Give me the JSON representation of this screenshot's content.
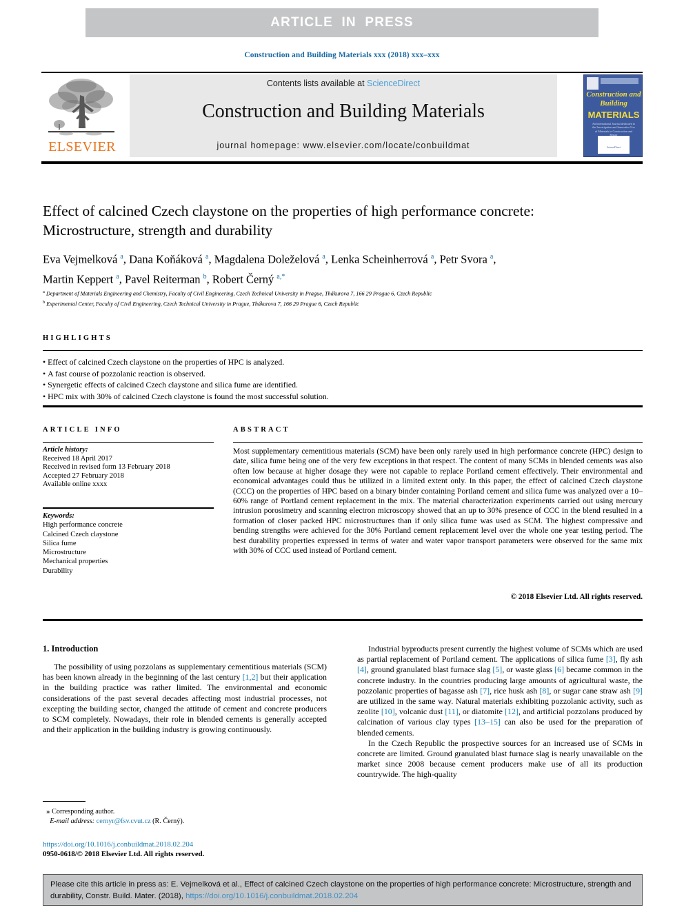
{
  "banner": {
    "text": "ARTICLE  IN  PRESS"
  },
  "journal_ref": "Construction and Building Materials xxx (2018) xxx–xxx",
  "masthead": {
    "contents_prefix": "Contents lists available at ",
    "sciencedirect": "ScienceDirect",
    "journal_title": "Construction and Building Materials",
    "homepage": "journal homepage: www.elsevier.com/locate/conbuildmat",
    "publisher": "ELSEVIER",
    "cover": {
      "line1": "Construction and Building",
      "line2": "MATERIALS",
      "blurb": "An International Journal dedicated to the Investigation and Innovative Use of Materials in Construction and Repair",
      "footer": "ScienceDirect"
    }
  },
  "article": {
    "title": "Effect of calcined Czech claystone on the properties of high performance concrete: Microstructure, strength and durability",
    "authors_line1": "Eva Vejmelková a, Dana Koňáková a, Magdalena Doleželová a, Lenka Scheinherrová a, Petr Svora a,",
    "authors_line2": "Martin Keppert a, Pavel Reiterman b, Robert Černý a,*",
    "affiliation_a": "Department of Materials Engineering and Chemistry, Faculty of Civil Engineering, Czech Technical University in Prague, Thákurova 7, 166 29 Prague 6, Czech Republic",
    "affiliation_b": "Experimental Center, Faculty of Civil Engineering, Czech Technical University in Prague, Thákurova 7, 166 29 Prague 6, Czech Republic"
  },
  "highlights": {
    "label": "HIGHLIGHTS",
    "items": [
      "Effect of calcined Czech claystone on the properties of HPC is analyzed.",
      "A fast course of pozzolanic reaction is observed.",
      "Synergetic effects of calcined Czech claystone and silica fume are identified.",
      "HPC mix with 30% of calcined Czech claystone is found the most successful solution."
    ]
  },
  "article_info": {
    "label": "ARTICLE INFO",
    "history_label": "Article history:",
    "history": [
      "Received 18 April 2017",
      "Received in revised form 13 February 2018",
      "Accepted 27 February 2018",
      "Available online xxxx"
    ],
    "keywords_label": "Keywords:",
    "keywords": [
      "High performance concrete",
      "Calcined Czech claystone",
      "Silica fume",
      "Microstructure",
      "Mechanical properties",
      "Durability"
    ]
  },
  "abstract": {
    "label": "ABSTRACT",
    "body": "Most supplementary cementitious materials (SCM) have been only rarely used in high performance concrete (HPC) design to date, silica fume being one of the very few exceptions in that respect. The content of many SCMs in blended cements was also often low because at higher dosage they were not capable to replace Portland cement effectively. Their environmental and economical advantages could thus be utilized in a limited extent only. In this paper, the effect of calcined Czech claystone (CCC) on the properties of HPC based on a binary binder containing Portland cement and silica fume was analyzed over a 10–60% range of Portland cement replacement in the mix. The material characterization experiments carried out using mercury intrusion porosimetry and scanning electron microscopy showed that an up to 30% presence of CCC in the blend resulted in a formation of closer packed HPC microstructures than if only silica fume was used as SCM. The highest compressive and bending strengths were achieved for the 30% Portland cement replacement level over the whole one year testing period. The best durability properties expressed in terms of water and water vapor transport parameters were observed for the same mix with 30% of CCC used instead of Portland cement.",
    "copyright": "© 2018 Elsevier Ltd. All rights reserved."
  },
  "body": {
    "section_heading": "1. Introduction",
    "left_paragraph": "The possibility of using pozzolans as supplementary cementitious materials (SCM) has been known already in the beginning of the last century [1,2] but their application in the building practice was rather limited. The environmental and economic considerations of the past several decades affecting most industrial processes, not excepting the building sector, changed the attitude of cement and concrete producers to SCM completely. Nowadays, their role in blended cements is generally accepted and their application in the building industry is growing continuously.",
    "right_paragraph_1": "Industrial byproducts present currently the highest volume of SCMs which are used as partial replacement of Portland cement. The applications of silica fume [3], fly ash [4], ground granulated blast furnace slag [5], or waste glass [6] became common in the concrete industry. In the countries producing large amounts of agricultural waste, the pozzolanic properties of bagasse ash [7], rice husk ash [8], or sugar cane straw ash [9] are utilized in the same way. Natural materials exhibiting pozzolanic activity, such as zeolite [10], volcanic dust [11], or diatomite [12], and artificial pozzolans produced by calcination of various clay types [13–15] can also be used for the preparation of blended cements.",
    "right_paragraph_2": "In the Czech Republic the prospective sources for an increased use of SCMs in concrete are limited. Ground granulated blast furnace slag is nearly unavailable on the market since 2008 because cement producers make use of all its production countrywide. The high-quality"
  },
  "footnote": {
    "corresponding": "Corresponding author.",
    "email_label": "E-mail address:",
    "email": "cernyr@fsv.cvut.cz",
    "email_owner": "(R. Černý).",
    "doi": "https://doi.org/10.1016/j.conbuildmat.2018.02.204",
    "issn": "0950-0618/© 2018 Elsevier Ltd. All rights reserved."
  },
  "cite_box": {
    "text_before": "Please cite this article in press as: E. Vejmelková et al., Effect of calcined Czech claystone on the properties of high performance concrete: Microstructure, strength and durability, Constr. Build. Mater. (2018), ",
    "doi": "https://doi.org/10.1016/j.conbuildmat.2018.02.204"
  },
  "colors": {
    "banner_gray": "#c4c5c7",
    "link_blue": "#1a7fb5",
    "sciencedirect_blue": "#4a9fd8",
    "elsevier_orange": "#e87722",
    "cover_blue": "#3d5a9e",
    "cover_yellow": "#f5dd3a"
  }
}
